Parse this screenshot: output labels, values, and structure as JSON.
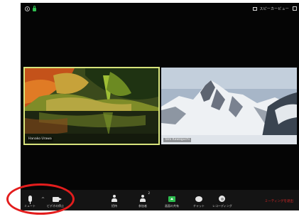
{
  "view": {
    "speaker_view_label": "スピーカービュー"
  },
  "participants": [
    {
      "name": "Hanako Urawa"
    },
    {
      "name": "Taro Kawaguchi"
    }
  ],
  "toolbar": {
    "mute_label": "ミュート",
    "video_label": "ビデオの停止",
    "invite_label": "招待",
    "participants_label": "参加者",
    "participants_count": "2",
    "share_label": "画面の共有",
    "chat_label": "チャット",
    "record_label": "レコーディング",
    "end_label": "ミーティングを退出"
  },
  "colors": {
    "active_speaker_border": "#d7e37c",
    "share_green": "#2dbd4e",
    "end_red": "#e02828",
    "annotation_ring": "#e31d1d"
  }
}
